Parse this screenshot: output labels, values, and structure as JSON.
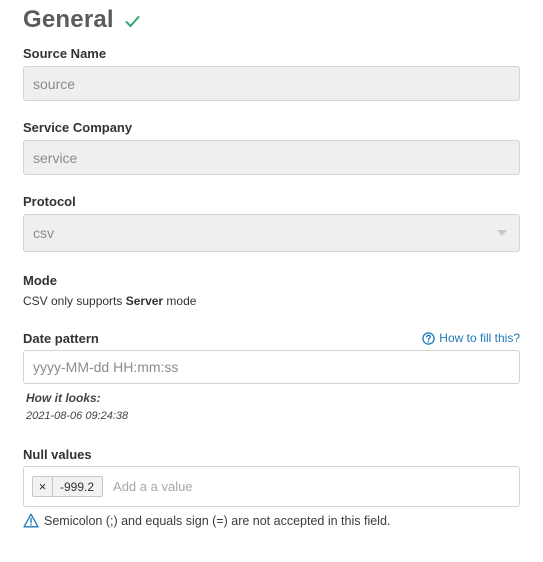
{
  "section": {
    "title": "General",
    "status_icon": "check-icon",
    "status_color": "#2bab6f"
  },
  "source_name": {
    "label": "Source Name",
    "value": "source"
  },
  "service_company": {
    "label": "Service Company",
    "value": "service"
  },
  "protocol": {
    "label": "Protocol",
    "value": "csv",
    "icon": "chevron-down-icon"
  },
  "mode": {
    "label": "Mode",
    "text_prefix": "CSV only supports ",
    "text_bold": "Server",
    "text_suffix": " mode"
  },
  "date_pattern": {
    "label": "Date pattern",
    "help_link": "How to fill this?",
    "help_icon": "question-circle-icon",
    "placeholder": "yyyy-MM-dd HH:mm:ss",
    "preview_label": "How it looks:",
    "preview_value": "2021-08-06 09:24:38"
  },
  "null_values": {
    "label": "Null values",
    "tags": [
      {
        "remove": "×",
        "value": "-999.2"
      }
    ],
    "placeholder": "Add a a value",
    "warning_icon": "warning-triangle-icon",
    "warning": "Semicolon (;) and equals sign (=) are not accepted in this field."
  },
  "colors": {
    "accent": "#1e7ab8",
    "warning": "#1e7ab8",
    "disabled_bg": "#efefef"
  }
}
